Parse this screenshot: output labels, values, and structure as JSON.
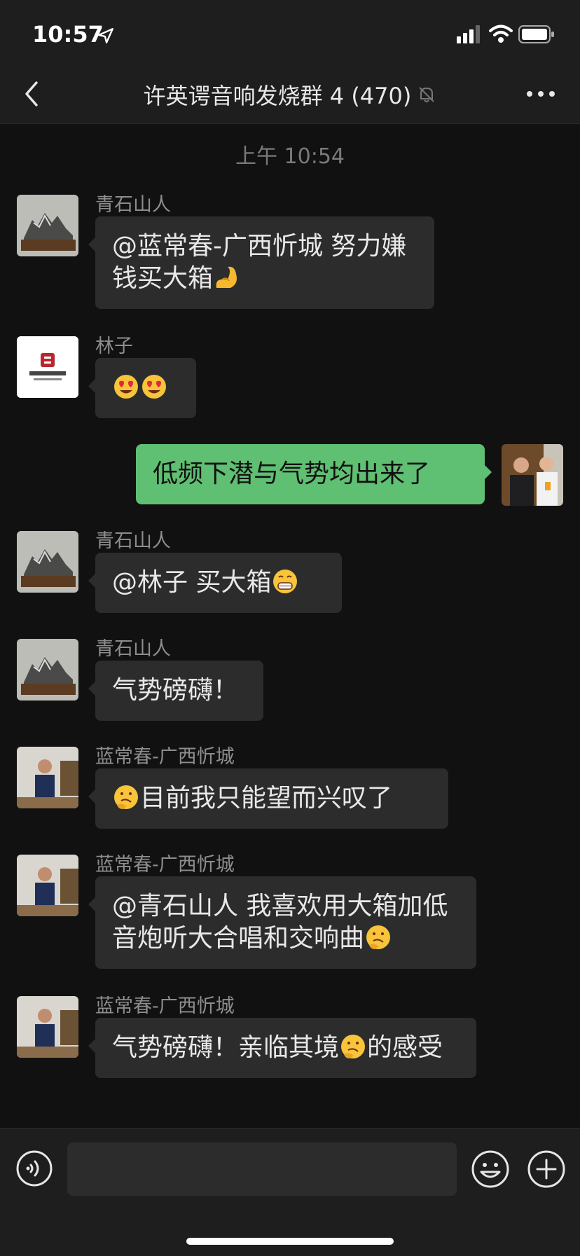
{
  "status": {
    "time": "10:57"
  },
  "nav": {
    "title": "许英谔音响发烧群 4 (470)"
  },
  "timestamp": "上午 10:54",
  "messages": [
    {
      "sender": "青石山人",
      "text": "@蓝常春-广西忻城 努力嫌钱买大箱",
      "emoji": "flexed-biceps"
    },
    {
      "sender": "林子",
      "emoji": [
        "heart-eyes",
        "heart-eyes"
      ]
    },
    {
      "self": true,
      "text": "低频下潜与气势均出来了"
    },
    {
      "sender": "青石山人",
      "text": "@林子 买大箱",
      "emoji": "grimacing"
    },
    {
      "sender": "青石山人",
      "text": "气势磅礴！"
    },
    {
      "sender": "蓝常春-广西忻城",
      "text": "目前我只能望而兴叹了",
      "emoji": "thinking"
    },
    {
      "sender": "蓝常春-广西忻城",
      "text": "@青石山人 我喜欢用大箱加低音炮听大合唱和交响曲",
      "emoji": "thinking"
    },
    {
      "sender": "蓝常春-广西忻城",
      "text_a": "气势磅礴！亲临其境",
      "text_b": "的感受",
      "emoji": "thinking"
    }
  ],
  "input": {
    "placeholder": ""
  },
  "colors": {
    "background": "#111111",
    "bubble": "#2c2c2c",
    "self_bubble": "#5fbf72"
  }
}
